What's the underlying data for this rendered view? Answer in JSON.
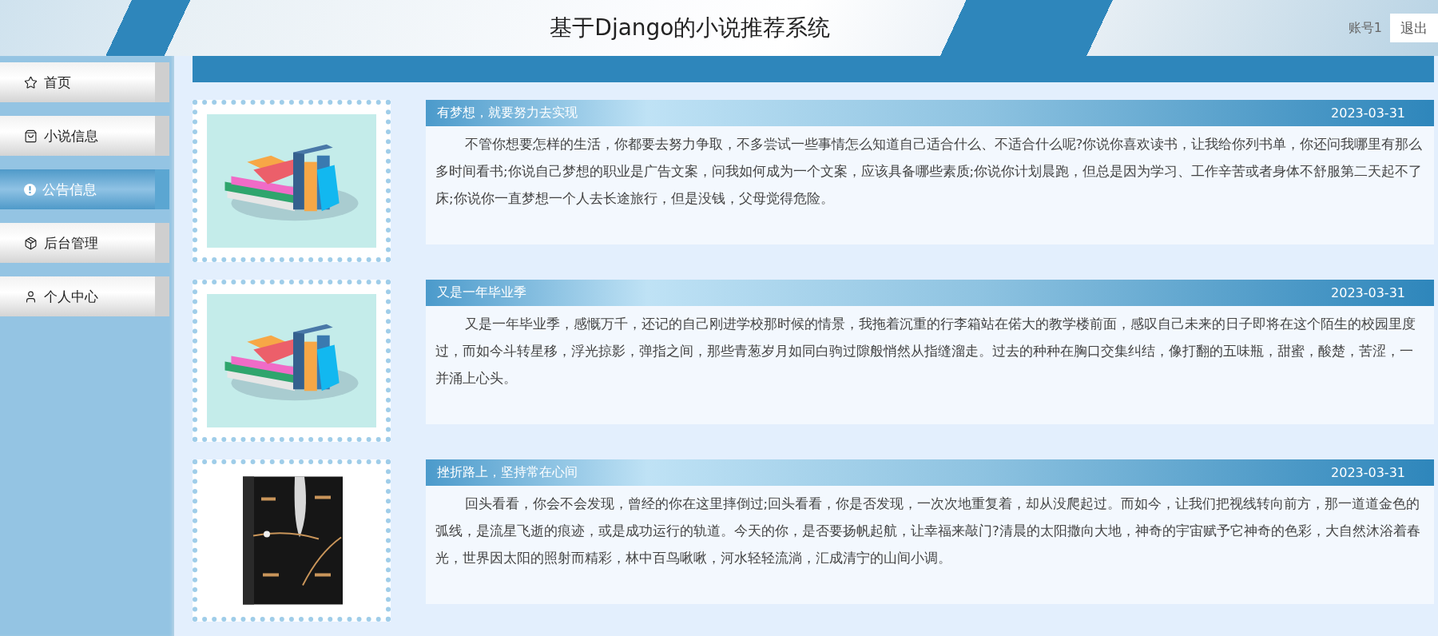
{
  "header": {
    "title": "基于Django的小说推荐系统",
    "account": "账号1",
    "logout": "退出"
  },
  "sidebar": {
    "items": [
      {
        "label": "首页",
        "selected": false
      },
      {
        "label": "小说信息",
        "selected": false
      },
      {
        "label": "公告信息",
        "selected": true
      },
      {
        "label": "后台管理",
        "selected": false
      },
      {
        "label": "个人中心",
        "selected": false
      }
    ]
  },
  "notices": [
    {
      "title": "有梦想，就要努力去实现",
      "date": "2023-03-31",
      "body": "不管你想要怎样的生活，你都要去努力争取，不多尝试一些事情怎么知道自己适合什么、不适合什么呢?你说你喜欢读书，让我给你列书单，你还问我哪里有那么多时间看书;你说自己梦想的职业是广告文案，问我如何成为一个文案，应该具备哪些素质;你说你计划晨跑，但总是因为学习、工作辛苦或者身体不舒服第二天起不了床;你说你一直梦想一个人去长途旅行，但是没钱，父母觉得危险。",
      "image": {
        "kind": "drawing"
      }
    },
    {
      "title": "又是一年毕业季",
      "date": "2023-03-31",
      "body": "又是一年毕业季，感慨万千，还记的自己刚进学校那时候的情景，我拖着沉重的行李箱站在偌大的教学楼前面，感叹自己未来的日子即将在这个陌生的校园里度过，而如今斗转星移，浮光掠影，弹指之间，那些青葱岁月如同白驹过隙般悄然从指缝溜走。过去的种种在胸口交集纠结，像打翻的五味瓶，甜蜜，酸楚，苦涩，一并涌上心头。",
      "image": {
        "kind": "drawing"
      }
    },
    {
      "title": "挫折路上，坚持常在心间",
      "date": "2023-03-31",
      "body": "回头看看，你会不会发现，曾经的你在这里摔倒过;回头看看，你是否发现，一次次地重复着，却从没爬起过。而如今，让我们把视线转向前方，那一道道金色的弧线，是流星飞逝的痕迹，或是成功运行的轨道。今天的你，是否要扬帆起航，让幸福来敲门?清晨的太阳撒向大地，神奇的宇宙赋予它神奇的色彩，大自然沐浴着春光，世界因太阳的照射而精彩，林中百鸟啾啾，河水轻轻流淌，汇成清宁的山间小调。"
    }
  ]
}
